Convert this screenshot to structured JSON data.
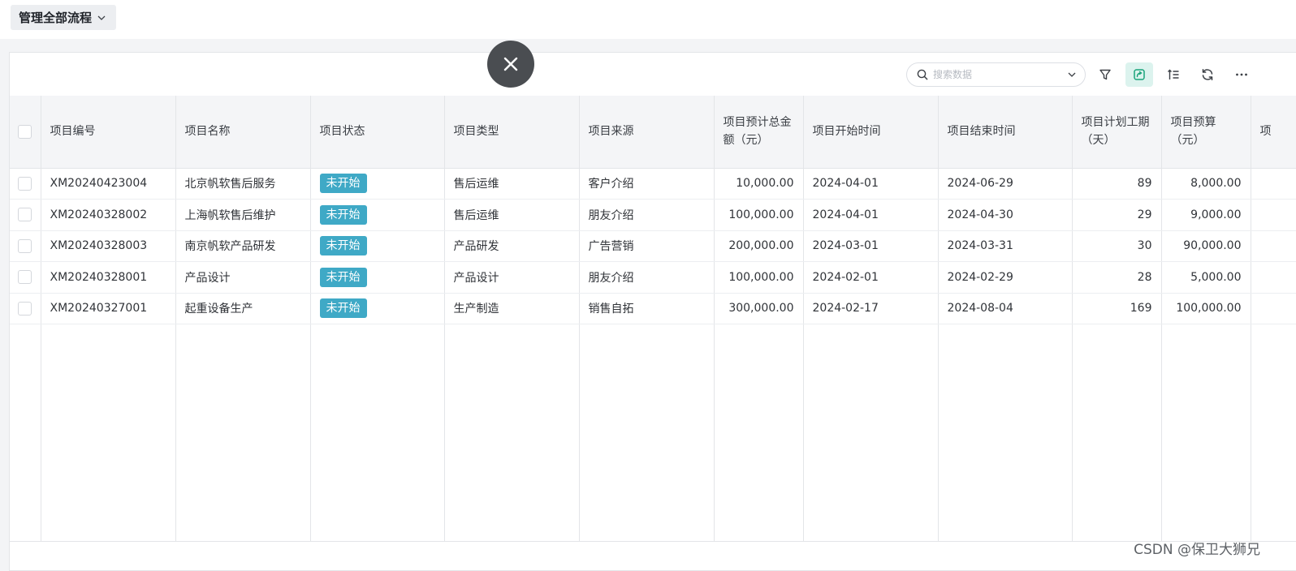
{
  "topbar": {
    "flow_label": "管理全部流程"
  },
  "toolbar": {
    "search_placeholder": "搜索数据",
    "icons": [
      "filter-icon",
      "card-view-icon",
      "sort-icon",
      "refresh-icon",
      "more-icon"
    ]
  },
  "table": {
    "headers": [
      "项目编号",
      "项目名称",
      "项目状态",
      "项目类型",
      "项目来源",
      "项目预计总金额（元）",
      "项目开始时间",
      "项目结束时间",
      "项目计划工期（天）",
      "项目预算（元）",
      "项"
    ],
    "rows": [
      {
        "code": "XM20240423004",
        "name": "北京帆软售后服务",
        "status": "未开始",
        "type": "售后运维",
        "source": "客户介绍",
        "amount": "10,000.00",
        "start": "2024-04-01",
        "end": "2024-06-29",
        "days": "89",
        "budget": "8,000.00"
      },
      {
        "code": "XM20240328002",
        "name": "上海帆软售后维护",
        "status": "未开始",
        "type": "售后运维",
        "source": "朋友介绍",
        "amount": "100,000.00",
        "start": "2024-04-01",
        "end": "2024-04-30",
        "days": "29",
        "budget": "9,000.00"
      },
      {
        "code": "XM20240328003",
        "name": "南京帆软产品研发",
        "status": "未开始",
        "type": "产品研发",
        "source": "广告营销",
        "amount": "200,000.00",
        "start": "2024-03-01",
        "end": "2024-03-31",
        "days": "30",
        "budget": "90,000.00"
      },
      {
        "code": "XM20240328001",
        "name": "产品设计",
        "status": "未开始",
        "type": "产品设计",
        "source": "朋友介绍",
        "amount": "100,000.00",
        "start": "2024-02-01",
        "end": "2024-02-29",
        "days": "28",
        "budget": "5,000.00"
      },
      {
        "code": "XM20240327001",
        "name": "起重设备生产",
        "status": "未开始",
        "type": "生产制造",
        "source": "销售自拓",
        "amount": "300,000.00",
        "start": "2024-02-17",
        "end": "2024-08-04",
        "days": "169",
        "budget": "100,000.00"
      }
    ]
  },
  "colors": {
    "status_bg": "#3fa9c6",
    "active_tool_bg": "#dcf3ee",
    "accent": "#1aa37a"
  },
  "watermark": "CSDN @保卫大狮兄"
}
